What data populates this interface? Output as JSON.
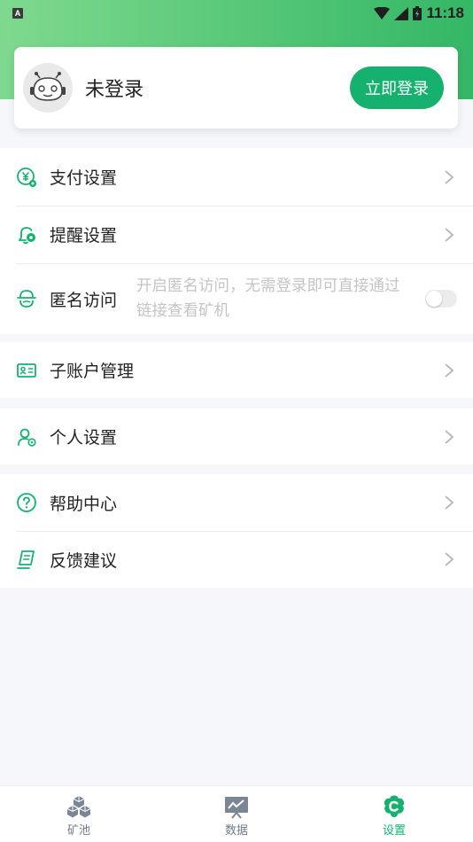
{
  "status_bar": {
    "sim_icon": "A",
    "time": "11:18"
  },
  "account": {
    "avatar_icon": "robot-avatar-icon",
    "status": "未登录",
    "login_button": "立即登录"
  },
  "colors": {
    "accent": "#16b16f",
    "header_start": "#7fd98e",
    "header_end": "#33b766"
  },
  "settings": {
    "group1": [
      {
        "label": "支付设置",
        "icon": "yuan-gear-icon"
      },
      {
        "label": "提醒设置",
        "icon": "bell-gear-icon"
      }
    ],
    "anonymous": {
      "label": "匿名访问",
      "icon": "incognito-icon",
      "description": "开启匿名访问，无需登录即可直接通过链接查看矿机",
      "enabled": false
    },
    "subaccount": {
      "label": "子账户管理",
      "icon": "id-card-icon"
    },
    "personal": {
      "label": "个人设置",
      "icon": "user-gear-icon"
    },
    "group4": [
      {
        "label": "帮助中心",
        "icon": "help-circle-icon"
      },
      {
        "label": "反馈建议",
        "icon": "feedback-note-icon"
      }
    ]
  },
  "tabbar": {
    "tabs": [
      {
        "label": "矿池",
        "icon": "cubes-icon",
        "active": false
      },
      {
        "label": "数据",
        "icon": "chart-board-icon",
        "active": false
      },
      {
        "label": "设置",
        "icon": "settings-flower-icon",
        "active": true
      }
    ]
  }
}
